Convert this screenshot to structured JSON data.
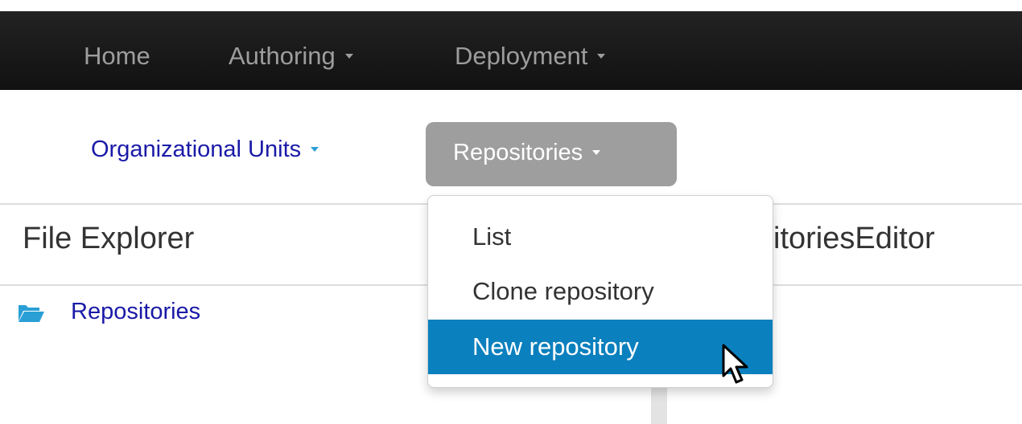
{
  "topnav": {
    "home": "Home",
    "authoring": "Authoring",
    "deployment": "Deployment"
  },
  "subnav": {
    "org_units": "Organizational Units",
    "repositories": "Repositories"
  },
  "panels": {
    "left_title": "File Explorer",
    "right_title": "sitoriesEditor"
  },
  "tree": {
    "root_label": "Repositories",
    "root_icon": "folder-open-icon"
  },
  "dropdown": {
    "items": [
      {
        "label": "List"
      },
      {
        "label": "Clone repository"
      },
      {
        "label": "New repository",
        "state": "hovered"
      }
    ]
  },
  "colors": {
    "navbar": "#111111",
    "nav_text": "#9d9d9d",
    "link": "#1a1aa8",
    "active_pill": "#9e9e9e",
    "highlight": "#0b80be",
    "icon_blue": "#2a9fd6"
  }
}
